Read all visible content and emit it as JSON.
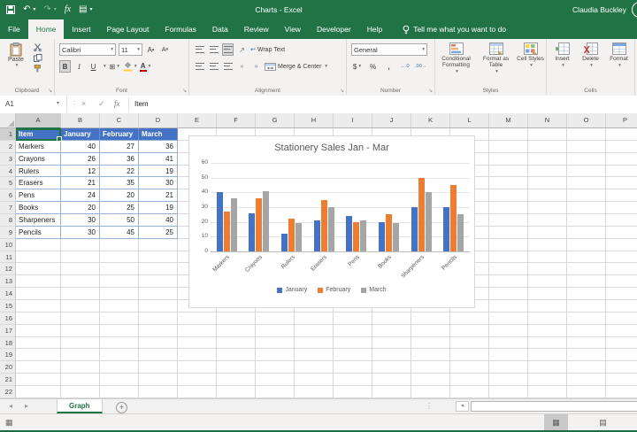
{
  "window": {
    "title": "Charts - Excel",
    "user": "Claudia Buckley"
  },
  "menu": {
    "file": "File",
    "tabs": [
      "Home",
      "Insert",
      "Page Layout",
      "Formulas",
      "Data",
      "Review",
      "View",
      "Developer",
      "Help"
    ],
    "active": "Home",
    "tell_me": "Tell me what you want to do"
  },
  "ribbon": {
    "clipboard": {
      "label": "Clipboard",
      "paste": "Paste"
    },
    "font": {
      "label": "Font",
      "name": "Calibri",
      "size": "11",
      "bold": "B",
      "italic": "I",
      "underline": "U",
      "grow": "A",
      "shrink": "A",
      "color_letter": "A"
    },
    "alignment": {
      "label": "Alignment",
      "wrap": "Wrap Text",
      "merge": "Merge & Center"
    },
    "number": {
      "label": "Number",
      "format": "General",
      "currency": "$",
      "percent": "%",
      "comma": ",",
      "dec_inc": "←.0",
      "dec_dec": ".00→"
    },
    "styles": {
      "label": "Styles",
      "items": [
        "Conditional Formatting",
        "Format as Table",
        "Cell Styles"
      ]
    },
    "cells": {
      "label": "Cells",
      "items": [
        "Insert",
        "Delete",
        "Format"
      ]
    }
  },
  "formula_bar": {
    "name_box": "A1",
    "content": "Item"
  },
  "sheet": {
    "columns": [
      "A",
      "B",
      "C",
      "D",
      "E",
      "F",
      "G",
      "H",
      "I",
      "J",
      "K",
      "L",
      "M",
      "N",
      "O",
      "P"
    ],
    "rows": 22,
    "selected_cell": "A1",
    "table": {
      "headers": [
        "Item",
        "January",
        "February",
        "March"
      ],
      "rows": [
        [
          "Markers",
          40,
          27,
          36
        ],
        [
          "Crayons",
          26,
          36,
          41
        ],
        [
          "Rulers",
          12,
          22,
          19
        ],
        [
          "Erasers",
          21,
          35,
          30
        ],
        [
          "Pens",
          24,
          20,
          21
        ],
        [
          "Books",
          20,
          25,
          19
        ],
        [
          "Sharpeners",
          30,
          50,
          40
        ],
        [
          "Pencils",
          30,
          45,
          25
        ]
      ]
    }
  },
  "chart_data": {
    "type": "bar",
    "title": "Stationery Sales Jan - Mar",
    "categories": [
      "Markers",
      "Crayons",
      "Rulers",
      "Erasers",
      "Pens",
      "Books",
      "Sharpeners",
      "Pencils"
    ],
    "series": [
      {
        "name": "January",
        "color": "#4472C4",
        "values": [
          40,
          26,
          12,
          21,
          24,
          20,
          30,
          30
        ]
      },
      {
        "name": "February",
        "color": "#ED7D31",
        "values": [
          27,
          36,
          22,
          35,
          20,
          25,
          50,
          45
        ]
      },
      {
        "name": "March",
        "color": "#A5A5A5",
        "values": [
          36,
          41,
          19,
          30,
          21,
          19,
          40,
          25
        ]
      }
    ],
    "ylim": [
      0,
      60
    ],
    "ytick": 10,
    "grid": true,
    "legend_position": "bottom",
    "xlabel": "",
    "ylabel": ""
  },
  "tab_bar": {
    "active_sheet": "Graph"
  },
  "colors": {
    "accent_green": "#217346",
    "table_header": "#4472C4"
  },
  "icons": {
    "dropdown": "▾",
    "undo": "↶",
    "redo": "↷",
    "fx": "fx",
    "qat_more": "▾",
    "doc": "▤",
    "cancel": "×",
    "enter": "✓",
    "borders": "⊞",
    "orientation": "↗",
    "wrap_arrow": "↩",
    "indent_left": "«",
    "indent_right": "»",
    "grow_caret": "▴",
    "shrink_caret": "▾",
    "tab_prev": "◂",
    "tab_next": "▸",
    "add_sheet": "+",
    "dots": "⋮",
    "scroll_left": "◂",
    "view_normal": "▦",
    "view_layout": "▤",
    "view_break": "◫",
    "macro": "▦"
  }
}
